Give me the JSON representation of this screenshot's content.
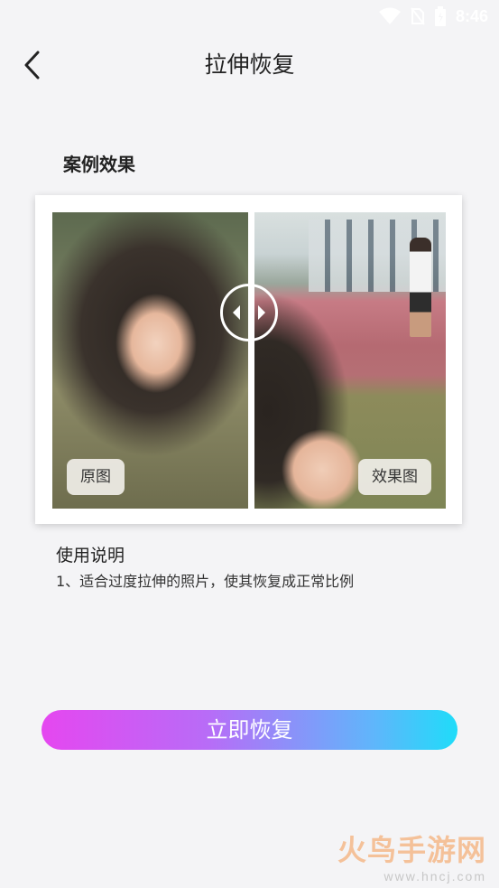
{
  "status_bar": {
    "time": "8:46"
  },
  "header": {
    "title": "拉伸恢复",
    "back_icon": "chevron-left-icon"
  },
  "section": {
    "title": "案例效果"
  },
  "comparison": {
    "left_label": "原图",
    "right_label": "效果图",
    "handle_icon": "compare-arrows-icon"
  },
  "usage": {
    "title": "使用说明",
    "text": "1、适合过度拉伸的照片，使其恢复成正常比例"
  },
  "main_button": {
    "label": "立即恢复",
    "gradient_start": "#e547f0",
    "gradient_end": "#1fdcf9"
  },
  "watermark": {
    "logo": "火鸟手游网",
    "url": "www.hncj.com"
  }
}
